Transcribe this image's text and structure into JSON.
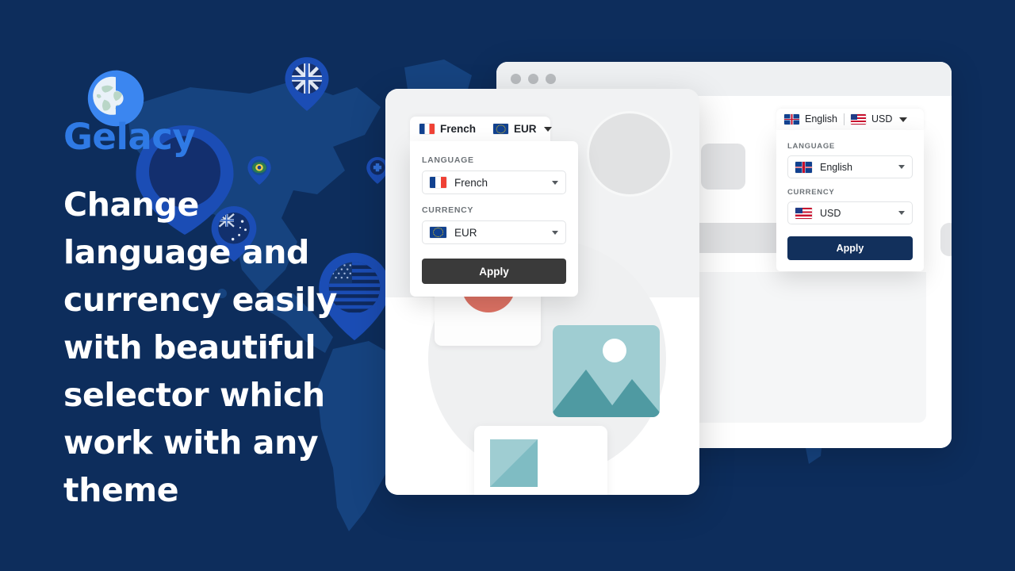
{
  "theme": {
    "background": "#0d2d5c",
    "brand_blue": "#2f7ae5",
    "map_land": "#16437f",
    "pin_blue": "#1b4db5",
    "apply_dark": "#3a3a3a",
    "apply_navy": "#12305c",
    "teal": "#9fcdd2",
    "salmon": "#dd7264",
    "label_gray": "#6d7378"
  },
  "brand": {
    "name": "Gelacy",
    "logo_icon": "globe-g-logo-icon"
  },
  "hero": {
    "headline": "Change\nlanguage and\ncurrency easily\nwith beautiful\nselector which\nwork with any\ntheme"
  },
  "map": {
    "pins": [
      {
        "name": "pin-united-kingdom",
        "flag": "gb",
        "label": "United Kingdom"
      },
      {
        "name": "pin-brazil",
        "flag": "br",
        "label": "Brazil"
      },
      {
        "name": "pin-switzerland",
        "flag": "ch",
        "label": "Switzerland"
      },
      {
        "name": "pin-australia",
        "flag": "au",
        "label": "Australia"
      },
      {
        "name": "pin-united-states",
        "flag": "us",
        "label": "United States"
      },
      {
        "name": "pin-generic",
        "flag": "none",
        "label": "Location"
      }
    ]
  },
  "rear_window": {
    "traffic_lights": [
      "close-dot",
      "minimize-dot",
      "maximize-dot"
    ]
  },
  "front_selector": {
    "bar": {
      "language_flag": "fr",
      "language_label": "French",
      "currency_flag": "eu",
      "currency_label": "EUR",
      "caret_icon": "chevron-down-icon"
    },
    "language": {
      "label": "LANGUAGE",
      "flag": "fr",
      "value": "French",
      "caret_icon": "chevron-down-icon"
    },
    "currency": {
      "label": "CURRENCY",
      "flag": "eu",
      "value": "EUR",
      "caret_icon": "chevron-down-icon"
    },
    "apply_label": "Apply",
    "apply_color": "#3a3a3a"
  },
  "rear_selector": {
    "bar": {
      "language_flag": "gb",
      "language_label": "English",
      "separator": "|",
      "currency_flag": "us",
      "currency_label": "USD",
      "caret_icon": "chevron-down-icon"
    },
    "language": {
      "label": "LANGUAGE",
      "flag": "gb",
      "value": "English",
      "caret_icon": "chevron-down-icon"
    },
    "currency": {
      "label": "CURRENCY",
      "flag": "us",
      "value": "USD",
      "caret_icon": "chevron-down-icon"
    },
    "apply_label": "Apply",
    "apply_color": "#12305c"
  }
}
